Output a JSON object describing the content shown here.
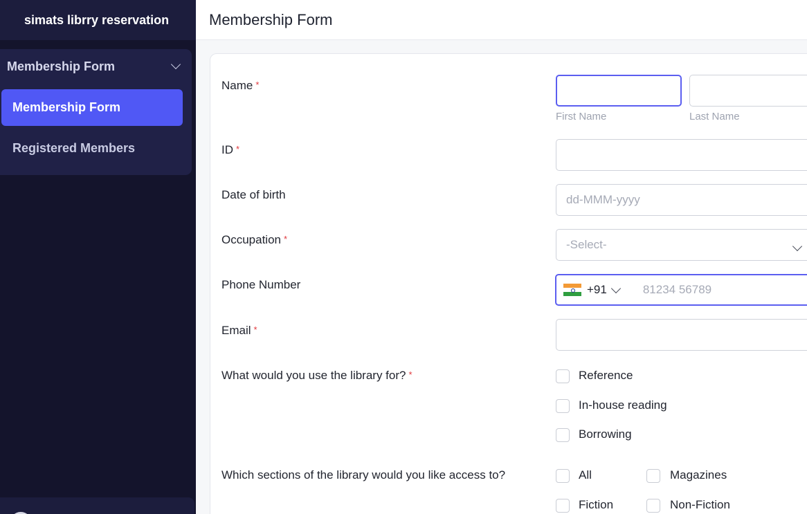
{
  "app": {
    "name": "simats librry reservation"
  },
  "sidebar": {
    "group_label": "Membership Form",
    "items": [
      {
        "label": "Membership Form",
        "active": true
      },
      {
        "label": "Registered Members",
        "active": false
      }
    ]
  },
  "header": {
    "title": "Membership Form"
  },
  "form": {
    "name": {
      "label": "Name",
      "required": "*",
      "first_sub": "First Name",
      "last_sub": "Last Name"
    },
    "id": {
      "label": "ID",
      "required": "*"
    },
    "dob": {
      "label": "Date of birth",
      "placeholder": "dd-MMM-yyyy"
    },
    "occupation": {
      "label": "Occupation",
      "required": "*",
      "selected": "-Select-"
    },
    "phone": {
      "label": "Phone Number",
      "country_code": "+91",
      "placeholder": "81234 56789"
    },
    "email": {
      "label": "Email",
      "required": "*"
    },
    "usage": {
      "label": "What would you use the library for?",
      "required": "*",
      "options": [
        "Reference",
        "In-house reading",
        "Borrowing"
      ]
    },
    "sections": {
      "label": "Which sections of the library would you like access to?",
      "options": [
        "All",
        "Magazines",
        "Fiction",
        "Non-Fiction"
      ]
    }
  },
  "colors": {
    "accent": "#5058f5",
    "sidebar_bg": "#14142c",
    "required": "#e0393e"
  }
}
